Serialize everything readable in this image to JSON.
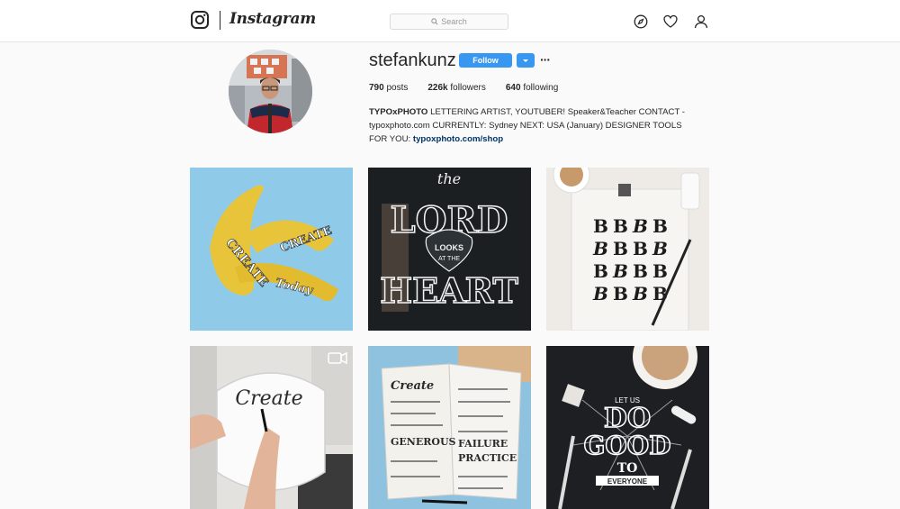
{
  "header": {
    "wordmark": "Instagram",
    "search_placeholder": "Search",
    "icons": [
      "instagram-logo-icon",
      "explore-compass-icon",
      "heart-icon",
      "profile-icon"
    ]
  },
  "profile": {
    "username": "stefankunz",
    "follow_label": "Follow",
    "more_label": "···",
    "stats": {
      "posts_count": "790",
      "posts_label": "posts",
      "followers_count": "226k",
      "followers_label": "followers",
      "following_count": "640",
      "following_label": "following"
    },
    "bio": {
      "name": "TYPOxPHOTO",
      "text": "LETTERING ARTIST, YOUTUBER! Speaker&Teacher CONTACT - typoxphoto.com CURRENTLY: Sydney NEXT: USA (January) DESIGNER TOOLS FOR YOU:",
      "link": "typoxphoto.com/shop"
    }
  },
  "posts": [
    {
      "lettering": [
        "CREATE",
        "Today"
      ]
    },
    {
      "lettering": [
        "the",
        "LORD",
        "LOOKS",
        "AT THE",
        "HEART"
      ]
    },
    {
      "lettering": [
        "B"
      ]
    },
    {
      "lettering": [
        "Create"
      ],
      "badge": "video-camera-icon"
    },
    {
      "lettering": [
        "Create",
        "GENEROUS",
        "FAILURE",
        "PRACTICE"
      ]
    },
    {
      "lettering": [
        "LET US",
        "DO",
        "GOOD",
        "TO",
        "EVERYONE"
      ]
    }
  ],
  "colors": {
    "accent": "#3897f0",
    "link": "#003569",
    "background": "#fafafa"
  }
}
